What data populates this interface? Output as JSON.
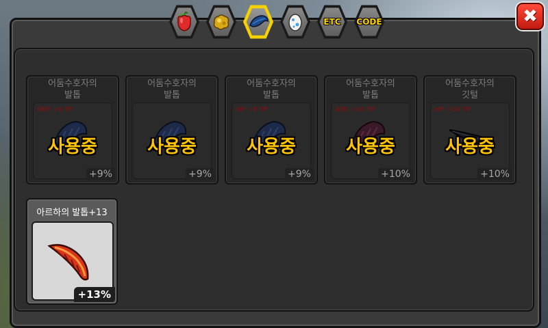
{
  "tabs": [
    {
      "id": "fruit",
      "icon": "red-fruit-icon",
      "label": ""
    },
    {
      "id": "gold",
      "icon": "gold-nugget-icon",
      "label": ""
    },
    {
      "id": "feather",
      "icon": "blue-feather-icon",
      "label": "",
      "active": true
    },
    {
      "id": "egg",
      "icon": "egg-icon",
      "label": ""
    },
    {
      "id": "etc",
      "icon": "",
      "label": "ETC"
    },
    {
      "id": "code",
      "icon": "",
      "label": "CODE"
    }
  ],
  "close_icon": "close-icon",
  "equipped": [
    {
      "name": "어둠수호자의\n발톱",
      "stat": "DEF +9 TP",
      "status": "사용중",
      "bonus": "+9%",
      "color": "#1e2a4a"
    },
    {
      "name": "어둠수호자의\n발톱",
      "stat": "",
      "status": "사용중",
      "bonus": "+9%",
      "color": "#1e2a4a"
    },
    {
      "name": "어둠수호자의\n발톱",
      "stat": "HP +9 TP",
      "status": "사용중",
      "bonus": "+9%",
      "color": "#1e2a4a"
    },
    {
      "name": "어둠수호자의\n발톱",
      "stat": "ATK +10 TP",
      "status": "사용중",
      "bonus": "+10%",
      "color": "#3a1a2a"
    },
    {
      "name": "어둠수호자의\n깃털",
      "stat": "HP +10 TP",
      "status": "사용중",
      "bonus": "+10%",
      "color": "#1a1a22"
    }
  ],
  "owned": [
    {
      "name": "아르하의 발톱+13",
      "bonus": "+13%"
    }
  ],
  "colors": {
    "accent": "#ffc400",
    "active_tab": "#f5d200",
    "close": "#e2271c"
  }
}
